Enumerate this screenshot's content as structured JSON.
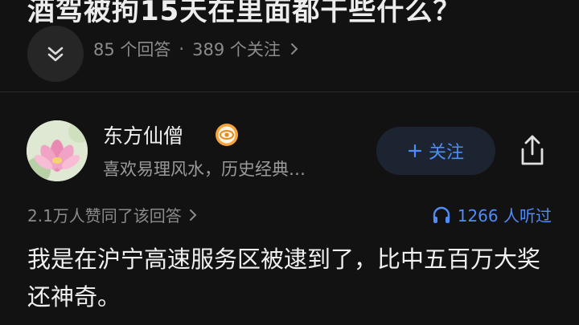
{
  "question": {
    "title": "酒驾被拘15天在里面都干些什么？",
    "answer_count": "85 个回答",
    "separator": "·",
    "follower_count": "389 个关注"
  },
  "answer": {
    "author": {
      "name": "东方仙僧",
      "bio": "喜欢易理风水，历史经典…"
    },
    "follow_label": "关注",
    "votes_text": "2.1万人赞同了该回答",
    "listeners_text": "1266 人听过",
    "content": "我是在沪宁高速服务区被逮到了，比中五百万大奖还神奇。"
  },
  "colors": {
    "background": "#121212",
    "accent": "#4f8cf7",
    "muted_text": "#8b8b8b"
  },
  "icons": [
    "chevron-down-icon",
    "chevron-right-icon",
    "verified-badge-icon",
    "plus-icon",
    "share-icon",
    "headphones-icon"
  ]
}
